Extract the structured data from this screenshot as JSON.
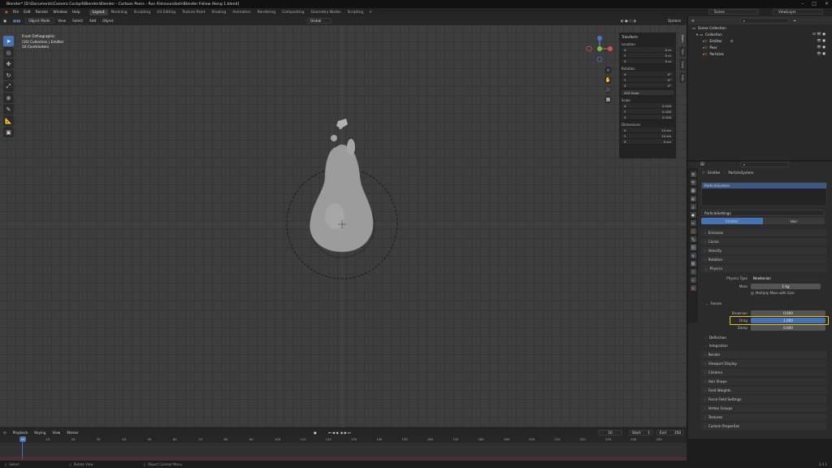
{
  "title_bar": "Blender* [D:\\Documents\\Camera Cockpit\\Blender\\Blender - Cartoon Pears - Run File\\soundash\\Blender Follow Along 1.blend]",
  "menu": [
    "File",
    "Edit",
    "Render",
    "Window",
    "Help"
  ],
  "workspaces": [
    "Layout",
    "Modeling",
    "Sculpting",
    "UV Editing",
    "Texture Paint",
    "Shading",
    "Animation",
    "Rendering",
    "Compositing",
    "Geometry Nodes",
    "Scripting"
  ],
  "active_workspace": "Layout",
  "scene": {
    "scene_label": "Scene",
    "view_layer_label": "ViewLayer"
  },
  "viewport_header": {
    "mode": "Object Mode",
    "menus": [
      "View",
      "Select",
      "Add",
      "Object"
    ],
    "orientation": "Global",
    "options_label": "Options"
  },
  "viewport_info": [
    "Front Orthographic",
    "(10) Collection | Emitter",
    "10 Centimeters"
  ],
  "n_panel": {
    "header": "Transform",
    "location_label": "Location",
    "location": [
      {
        "axis": "X",
        "val": "0 m"
      },
      {
        "axis": "Y",
        "val": "0 m"
      },
      {
        "axis": "Z",
        "val": "0 m"
      }
    ],
    "rotation_label": "Rotation",
    "rotation": [
      {
        "axis": "X",
        "val": "0°"
      },
      {
        "axis": "Y",
        "val": "0°"
      },
      {
        "axis": "Z",
        "val": "0°"
      }
    ],
    "rotation_mode": "XYZ Euler",
    "scale_label": "Scale",
    "scale": [
      {
        "axis": "X",
        "val": "0.100"
      },
      {
        "axis": "Y",
        "val": "0.100"
      },
      {
        "axis": "Z",
        "val": "0.100"
      }
    ],
    "dimensions_label": "Dimensions",
    "dimensions": [
      {
        "axis": "X",
        "val": "10 cm"
      },
      {
        "axis": "Y",
        "val": "10 cm"
      },
      {
        "axis": "Z",
        "val": "0 cm"
      }
    ],
    "tabs": [
      "Item",
      "Tool",
      "View",
      "Edit"
    ]
  },
  "outliner": {
    "scene_collection": "Scene Collection",
    "collection": "Collection",
    "items": [
      "Emitter",
      "Pear",
      "Particles"
    ]
  },
  "properties": {
    "breadcrumb_obj": "Emitter",
    "breadcrumb_sys": "ParticleSystem",
    "system_name": "ParticleSystem",
    "settings_name": "ParticleSettings",
    "type_tabs": [
      "Emitter",
      "Hair"
    ],
    "sections_top": [
      "Emission",
      "Cache",
      "Velocity",
      "Rotation",
      "Physics"
    ],
    "physics_type_label": "Physics Type",
    "physics_type_value": "Newtonian",
    "mass_label": "Mass",
    "mass_value": "1 kg",
    "multiply_label": "Multiply Mass with Size",
    "forces_label": "Forces",
    "brownian_label": "Brownian",
    "brownian_value": "0.000",
    "drag_label": "Drag",
    "drag_value": "1.000",
    "damp_label": "Damp",
    "damp_value": "0.000",
    "sections_bottom": [
      "Deflection",
      "Integration",
      "Render",
      "Viewport Display",
      "Children",
      "Hair Shape",
      "Field Weights",
      "Force Field Settings",
      "Vertex Groups",
      "Textures",
      "Custom Properties"
    ]
  },
  "timeline": {
    "menus": [
      "Playback",
      "Keying",
      "View",
      "Marker"
    ],
    "current_frame": "10",
    "start_label": "Start",
    "start": "1",
    "end_label": "End",
    "end": "250",
    "ticks": [
      "0",
      "10",
      "20",
      "30",
      "40",
      "50",
      "60",
      "70",
      "80",
      "90",
      "100",
      "110",
      "120",
      "130",
      "140",
      "150",
      "160",
      "170",
      "180",
      "190",
      "200",
      "210",
      "220",
      "230",
      "240",
      "250"
    ]
  },
  "status": {
    "select": "Select",
    "rotate": "Rotate View",
    "context": "Object Context Menu",
    "version": "3.4.1"
  }
}
